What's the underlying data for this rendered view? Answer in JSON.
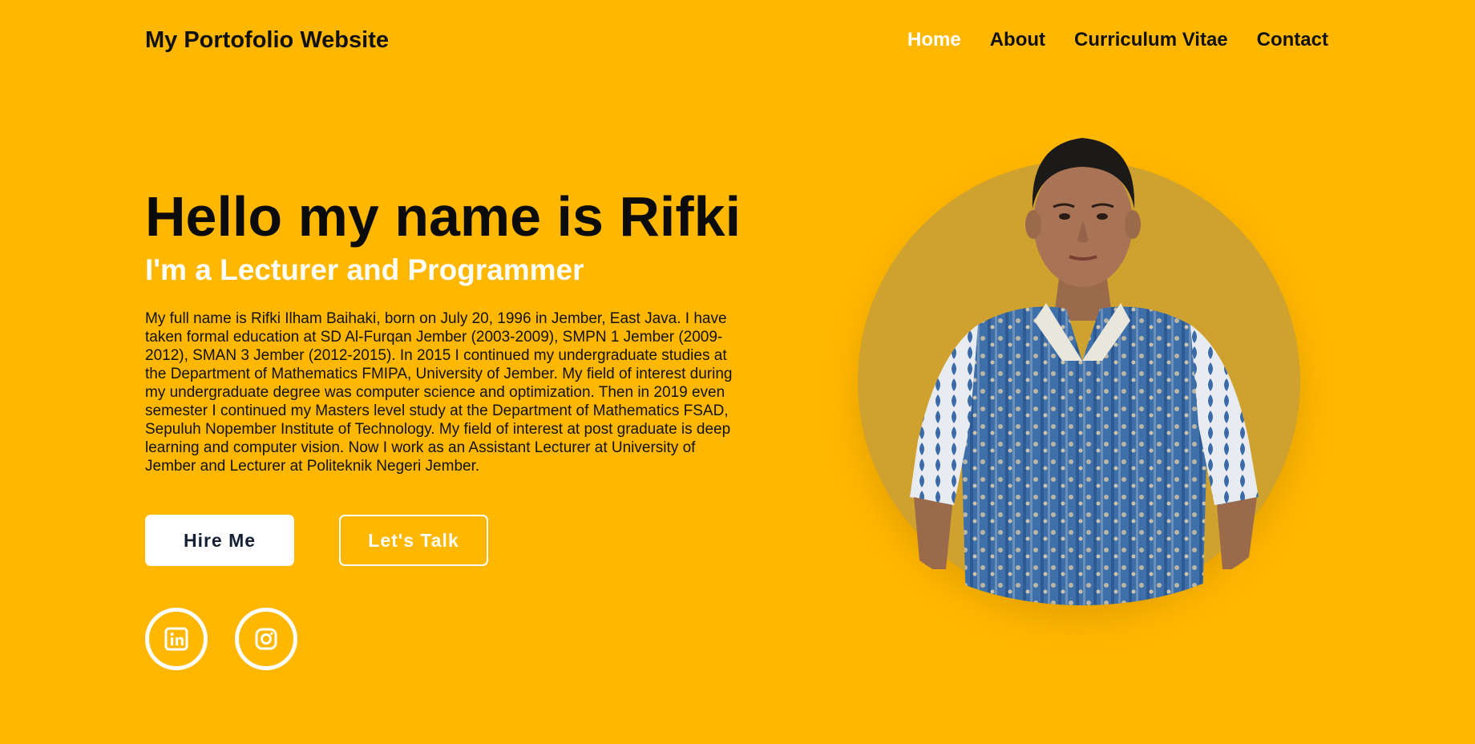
{
  "header": {
    "logo": "My Portofolio Website",
    "nav": [
      "Home",
      "About",
      "Curriculum Vitae",
      "Contact"
    ],
    "active_nav": "Home"
  },
  "hero": {
    "title": "Hello my name is Rifki",
    "subtitle": "I'm a Lecturer and Programmer",
    "bio": "My full name is Rifki Ilham Baihaki, born on July 20, 1996 in Jember, East Java. I have taken formal education at SD Al-Furqan Jember (2003-2009), SMPN 1 Jember (2009-2012), SMAN 3 Jember (2012-2015). In 2015 I continued my undergraduate studies at the Department of Mathematics FMIPA, University of Jember. My field of interest during my undergraduate degree was computer science and optimization. Then in 2019 even semester I continued my Masters level study at the Department of Mathematics FSAD, Sepuluh Nopember Institute of Technology. My field of interest at post graduate is deep learning and computer vision. Now I work as an Assistant Lecturer at University of Jember and Lecturer at Politeknik Negeri Jember."
  },
  "buttons": {
    "hire": "Hire Me",
    "talk": "Let's Talk"
  },
  "social": [
    {
      "icon": "linkedin-icon"
    },
    {
      "icon": "instagram-icon"
    }
  ],
  "colors": {
    "background": "#FFB700",
    "accent_circle": "#cfa12e",
    "text": "#111111",
    "white": "#ffffff"
  }
}
